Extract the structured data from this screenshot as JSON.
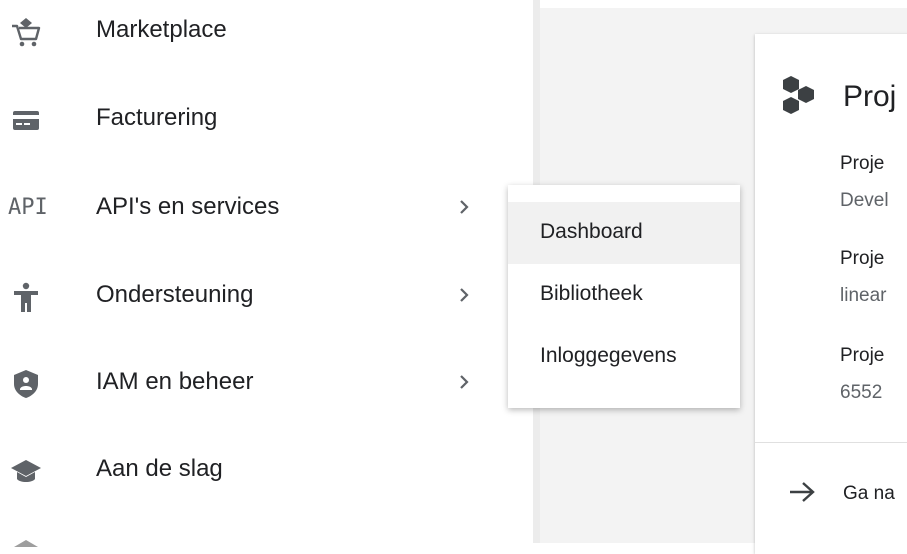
{
  "nav": {
    "items": [
      {
        "label": "Marketplace",
        "icon": "cart-icon",
        "has_submenu": false
      },
      {
        "label": "Facturering",
        "icon": "credit-card-icon",
        "has_submenu": false
      },
      {
        "label": "API's en services",
        "icon": "api-icon",
        "icon_text": "API",
        "has_submenu": true
      },
      {
        "label": "Ondersteuning",
        "icon": "support-person-icon",
        "has_submenu": true
      },
      {
        "label": "IAM en beheer",
        "icon": "shield-icon",
        "has_submenu": true
      },
      {
        "label": "Aan de slag",
        "icon": "graduation-cap-icon",
        "has_submenu": false
      }
    ]
  },
  "submenu": {
    "items": [
      {
        "label": "Dashboard",
        "active": true
      },
      {
        "label": "Bibliotheek",
        "active": false
      },
      {
        "label": "Inloggegevens",
        "active": false
      }
    ]
  },
  "card": {
    "title": "Proj",
    "info": [
      {
        "label": "Proje",
        "value": "Devel"
      },
      {
        "label": "Proje",
        "value": "linear"
      },
      {
        "label": "Proje",
        "value": "6552"
      }
    ],
    "goto_label": "Ga na"
  },
  "colors": {
    "icon_gray": "#5f6368",
    "text": "#202124",
    "secondary_text": "#5f6368",
    "submenu_active_bg": "#f1f1f1"
  }
}
